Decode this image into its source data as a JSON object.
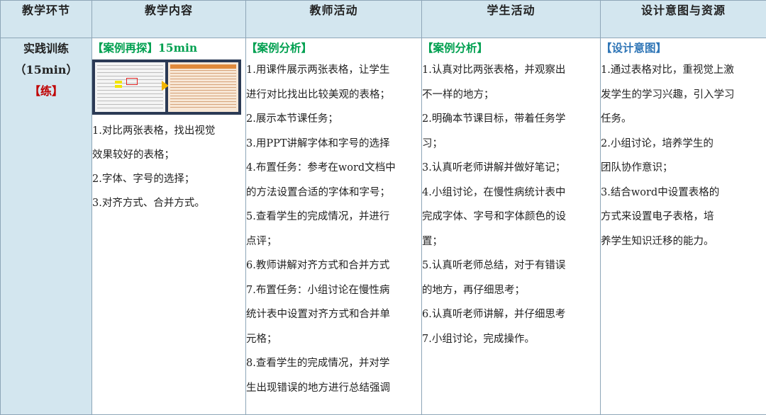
{
  "headers": [
    "教学环节",
    "教学内容",
    "教师活动",
    "学生活动",
    "设计意图与资源"
  ],
  "stage": {
    "name": "实践训练",
    "duration": "（15min）",
    "tag": "【练】"
  },
  "content": {
    "title": "【案例再探】15min",
    "items": [
      "1.对比两张表格，找出视觉",
      "效果较好的表格；",
      "2.字体、字号的选择；",
      "3.对齐方式、合并方式。"
    ]
  },
  "teacher": {
    "title": "【案例分析】",
    "items": [
      "1.用课件展示两张表格，让学生",
      "进行对比找出比较美观的表格；",
      "2.展示本节课任务；",
      "3.用PPT讲解字体和字号的选择",
      "4.布置任务：参考在word文档中",
      "的方法设置合适的字体和字号；",
      "5.查看学生的完成情况，并进行",
      "点评；",
      "6.教师讲解对齐方式和合并方式",
      "7.布置任务：小组讨论在慢性病",
      "统计表中设置对齐方式和合并单",
      "元格；",
      "8.查看学生的完成情况，并对学",
      "生出现错误的地方进行总结强调"
    ]
  },
  "student": {
    "title": "【案例分析】",
    "items": [
      "1.认真对比两张表格，并观察出",
      "不一样的地方；",
      "2.明确本节课目标，带着任务学",
      "习；",
      "3.认真听老师讲解并做好笔记；",
      "4.小组讨论，在慢性病统计表中",
      "完成字体、字号和字体颜色的设",
      "置；",
      "5.认真听老师总结，对于有错误",
      "的地方，再仔细思考；",
      "6.认真听老师讲解，并仔细思考",
      "7.小组讨论，完成操作。"
    ]
  },
  "design": {
    "title": "【设计意图】",
    "items": [
      "1.通过表格对比，重视觉上激",
      "发学生的学习兴趣，引入学习",
      "任务。",
      "2.小组讨论，培养学生的",
      "团队协作意识；",
      "3.结合word中设置表格的",
      "方式来设置电子表格，培",
      "养学生知识迁移的能力。"
    ]
  },
  "colors": {
    "header_bg": "#d3e6ef",
    "title_green": "#00a050",
    "title_blue": "#2e75b6",
    "tag_red": "#c00000"
  }
}
